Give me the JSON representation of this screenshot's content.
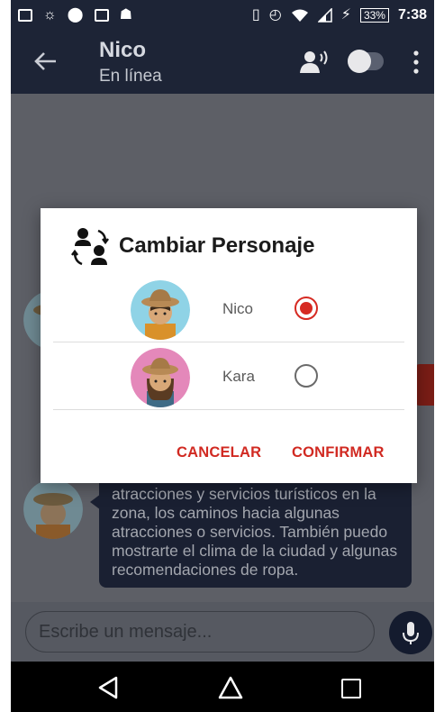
{
  "status_bar": {
    "battery": "33%",
    "time": "7:38"
  },
  "app_bar": {
    "title": "Nico",
    "subtitle": "En línea"
  },
  "chat": {
    "bubble_text": "atracciones y servicios turísticos en la zona, los caminos hacia algunas atracciones o servicios. También puedo mostrarte el clima de la ciudad y algunas recomendaciones de ropa."
  },
  "input": {
    "placeholder": "Escribe un mensaje..."
  },
  "dialog": {
    "title": "Cambiar Personaje",
    "options": [
      {
        "label": "Nico",
        "selected": true
      },
      {
        "label": "Kara",
        "selected": false
      }
    ],
    "cancel_label": "CANCELAR",
    "confirm_label": "CONFIRMAR"
  },
  "colors": {
    "primary_dark": "#1d2436",
    "accent": "#d62a22"
  }
}
